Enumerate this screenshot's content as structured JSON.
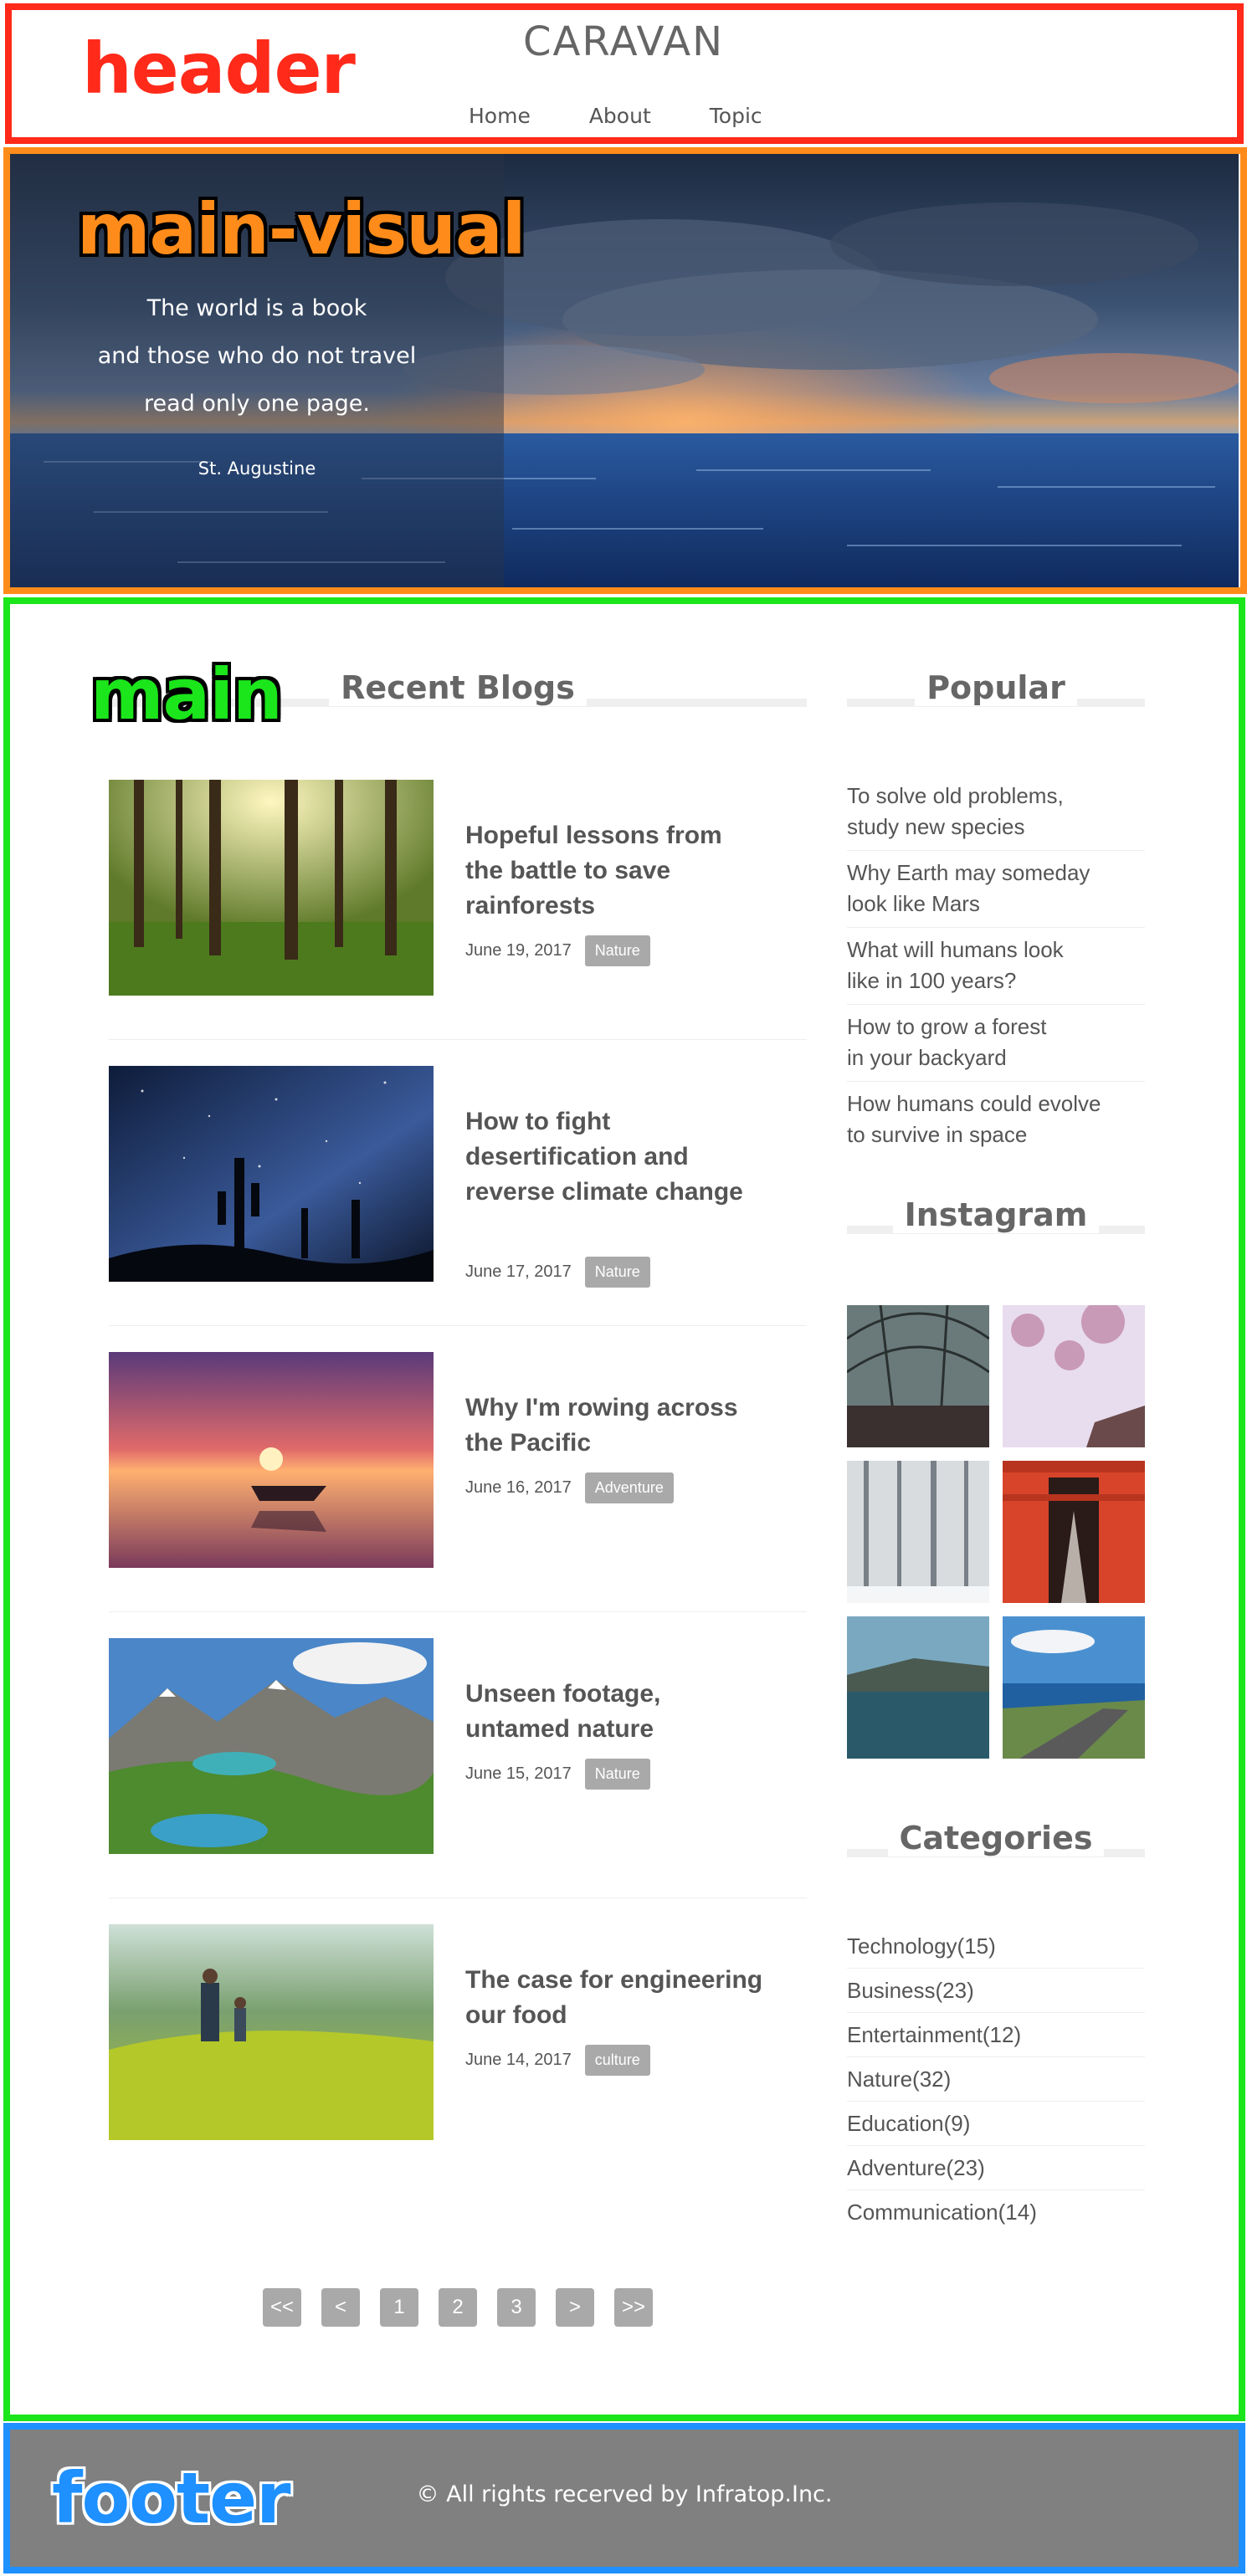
{
  "annotations": {
    "header": {
      "label": "header",
      "color": "#ff2a1a"
    },
    "main_visual": {
      "label": "main-visual",
      "color": "#ff8c1a"
    },
    "main": {
      "label": "main",
      "color": "#1be51b"
    },
    "footer": {
      "label": "footer",
      "color": "#1e90ff"
    }
  },
  "header": {
    "site_title": "CARAVAN",
    "nav": [
      "Home",
      "About",
      "Topic"
    ]
  },
  "hero": {
    "quote_lines": [
      "The world is a book",
      "and those who do not travel",
      "read only one page."
    ],
    "author": "St. Augustine"
  },
  "main": {
    "recent_heading": "Recent Blogs",
    "posts": [
      {
        "title": "Hopeful lessons from the battle to save rainforests",
        "date": "June 19, 2017",
        "tag": "Nature",
        "image": "forest-photo"
      },
      {
        "title": "How to fight desertification and reverse climate change",
        "date": "June 17, 2017",
        "tag": "Nature",
        "image": "night-sky-cactus-photo"
      },
      {
        "title": "Why I'm rowing across the Pacific",
        "date": "June 16, 2017",
        "tag": "Adventure",
        "image": "sunset-boat-photo"
      },
      {
        "title": "Unseen footage, untamed nature",
        "date": "June 15, 2017",
        "tag": "Nature",
        "image": "mountain-lake-photo"
      },
      {
        "title": "The case for engineering our food",
        "date": "June 14, 2017",
        "tag": "culture",
        "image": "rice-field-photo"
      }
    ],
    "pagination": [
      "<<",
      "<",
      "1",
      "2",
      "3",
      ">",
      ">>"
    ]
  },
  "sidebar": {
    "popular_heading": "Popular",
    "popular": [
      [
        "To solve old problems,",
        "study new species"
      ],
      [
        "Why Earth may someday",
        "look like Mars"
      ],
      [
        "What will humans look",
        "like in 100 years?"
      ],
      [
        "How to grow a forest",
        "in your backyard"
      ],
      [
        "How humans could evolve",
        "to survive in space"
      ]
    ],
    "instagram_heading": "Instagram",
    "instagram": [
      "glass-dome-photo",
      "cherry-blossom-photo",
      "snowy-forest-photo",
      "torii-gates-photo",
      "coastal-lake-photo",
      "coast-road-photo"
    ],
    "categories_heading": "Categories",
    "categories": [
      "Technology(15)",
      "Business(23)",
      "Entertainment(12)",
      "Nature(32)",
      "Education(9)",
      "Adventure(23)",
      "Communication(14)"
    ]
  },
  "footer": {
    "copyright": "© All rights recerved by Infratop.Inc."
  }
}
